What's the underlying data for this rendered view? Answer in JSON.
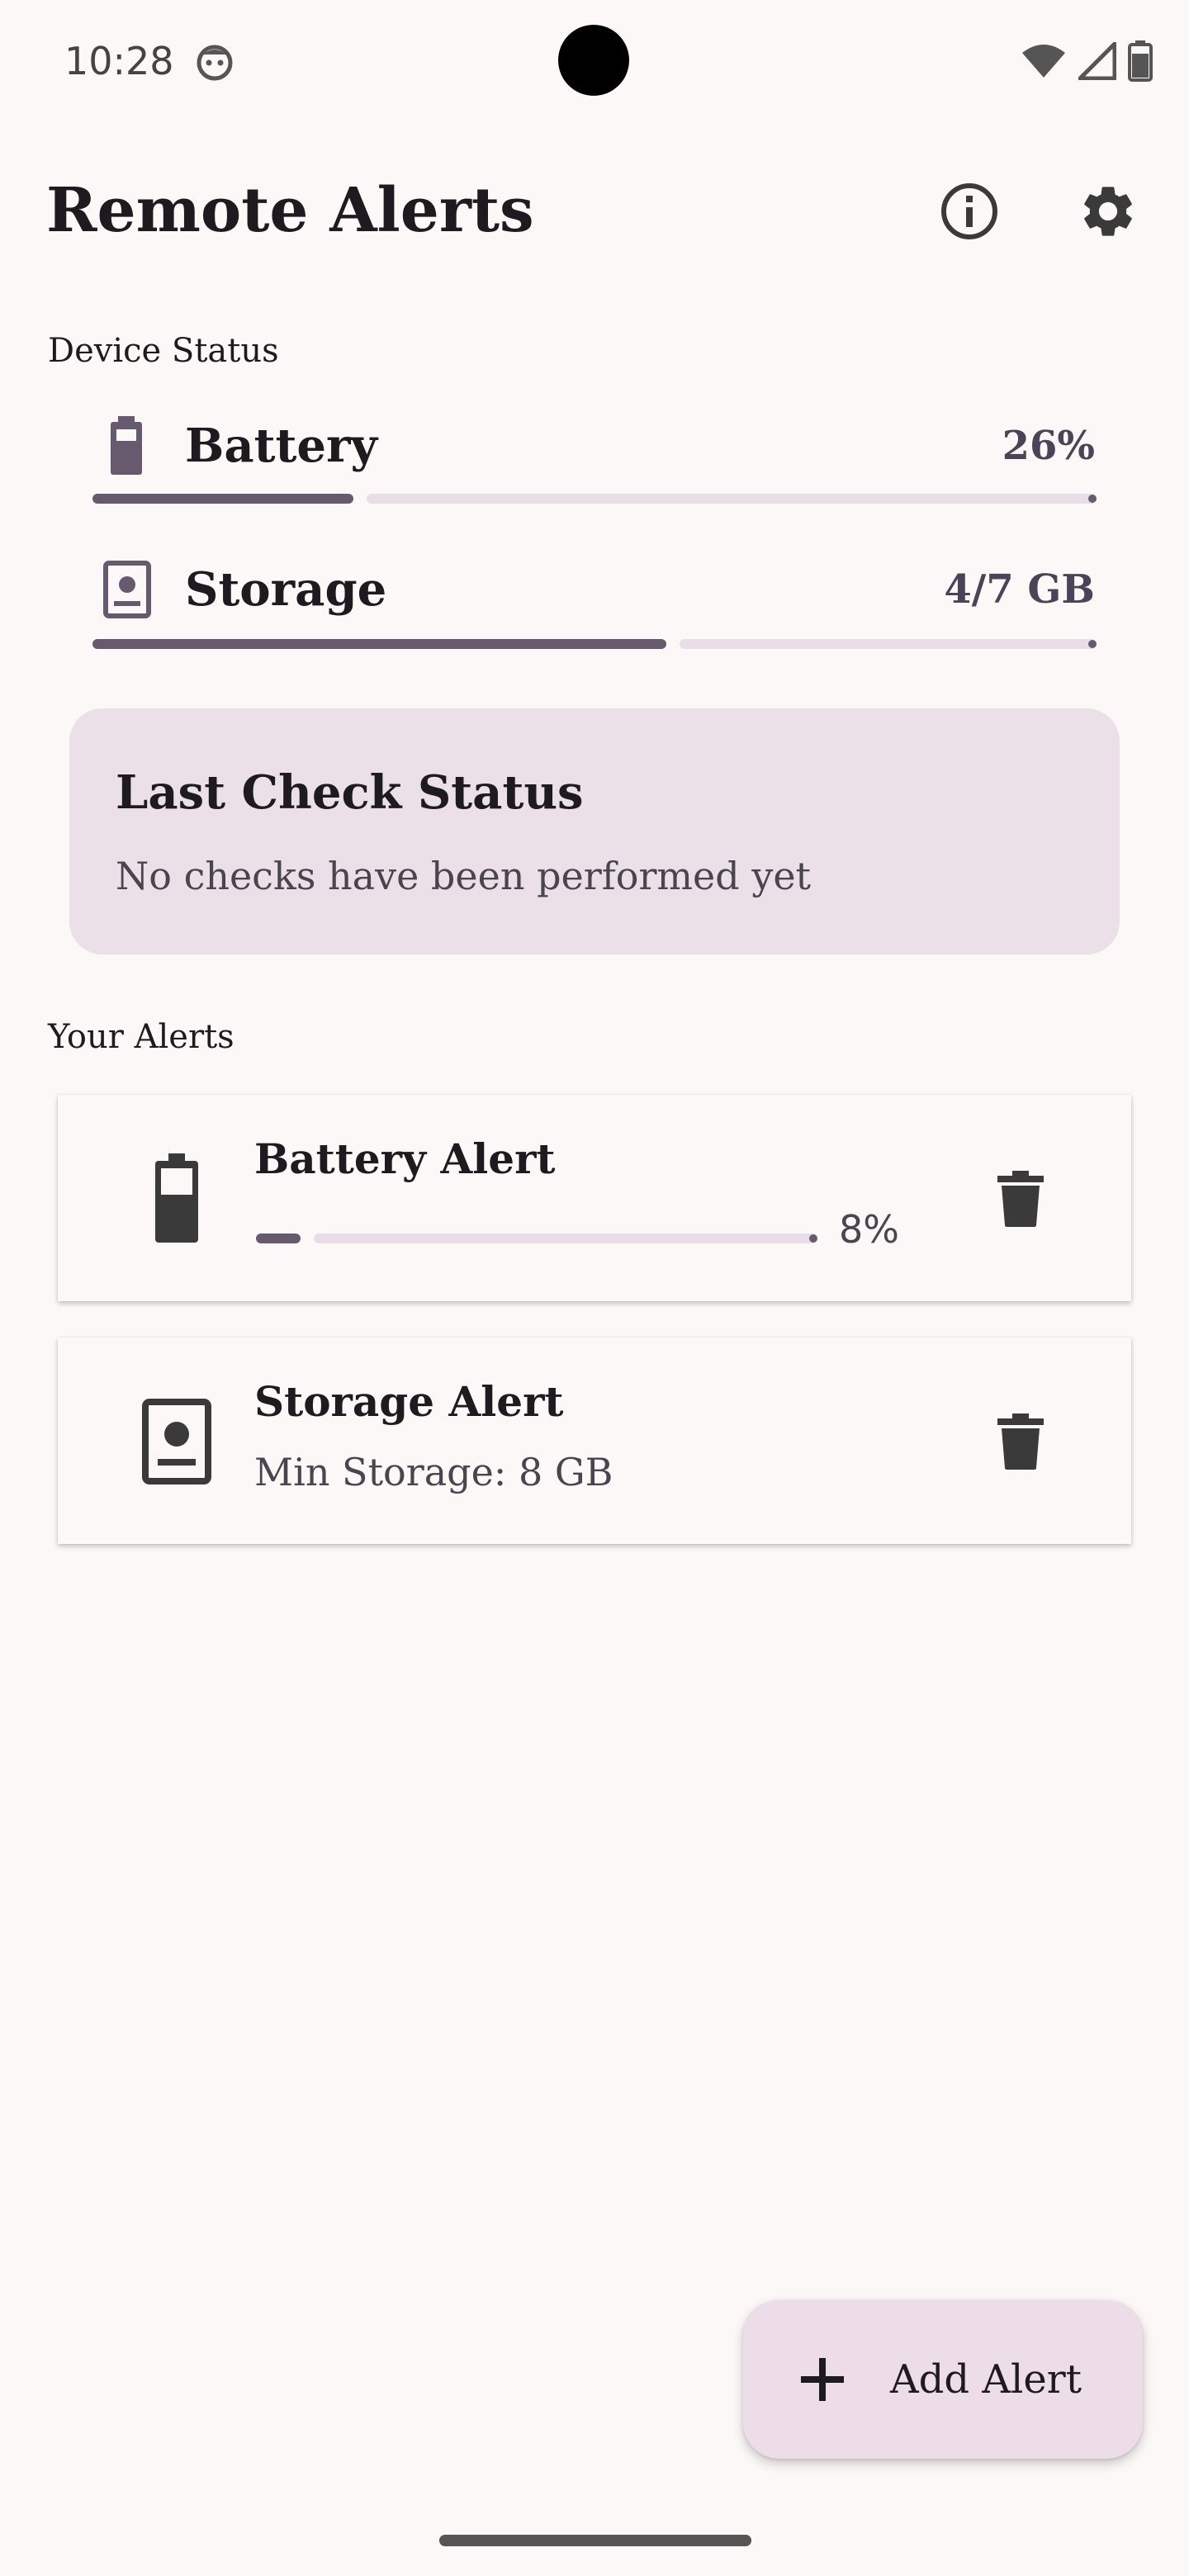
{
  "status_bar": {
    "time": "10:28",
    "icons": [
      "wifi-icon",
      "signal-icon",
      "battery-icon"
    ]
  },
  "header": {
    "title": "Remote Alerts",
    "info_icon": "info-icon",
    "settings_icon": "gear-icon"
  },
  "device_status": {
    "label": "Device Status",
    "battery": {
      "label": "Battery",
      "value": "26%",
      "progress": 0.26,
      "icon": "battery-icon"
    },
    "storage": {
      "label": "Storage",
      "value": "4/7 GB",
      "progress": 0.5714,
      "icon": "storage-icon"
    }
  },
  "last_check": {
    "title": "Last Check Status",
    "text": "No checks have been performed yet"
  },
  "alerts": {
    "label": "Your Alerts",
    "items": [
      {
        "title": "Battery Alert",
        "percent": "8%",
        "progress": 0.08,
        "icon": "battery-icon",
        "delete_icon": "trash-icon"
      },
      {
        "title": "Storage Alert",
        "subtitle": "Min Storage: 8 GB",
        "icon": "storage-icon",
        "delete_icon": "trash-icon"
      }
    ]
  },
  "fab": {
    "label": "Add Alert",
    "icon": "plus-icon"
  },
  "colors": {
    "background": "#fdf8f8",
    "accent": "#675a6e",
    "track": "#e9dee8",
    "card": "#ebdfe8",
    "fab": "#eddde9"
  }
}
